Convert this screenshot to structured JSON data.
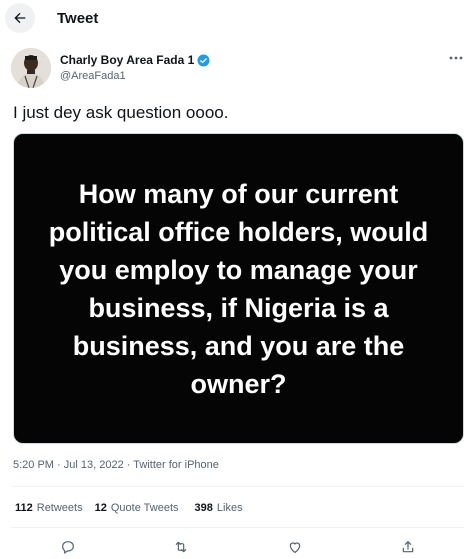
{
  "header": {
    "title": "Tweet",
    "back_icon": "arrow-left-icon"
  },
  "author": {
    "display_name": "Charly Boy Area Fada 1",
    "handle": "@AreaFada1",
    "verified": true,
    "verified_color": "#1d9bf0"
  },
  "tweet": {
    "text": "I just dey ask question oooo.",
    "media_text": "How many of our current political office holders, would you employ to manage your business, if Nigeria is a business, and you are the owner?",
    "time": "5:20 PM",
    "separator": "·",
    "date": "Jul 13, 2022",
    "source": "Twitter for iPhone"
  },
  "stats": {
    "retweets_count": "112",
    "retweets_label": "Retweets",
    "quote_count": "12",
    "quote_label": "Quote Tweets",
    "likes_count": "398",
    "likes_label": "Likes"
  },
  "actions": [
    "reply-icon",
    "retweet-icon",
    "like-icon",
    "share-icon"
  ],
  "colors": {
    "text": "#0f1419",
    "muted": "#536471",
    "media_bg": "#050505"
  }
}
